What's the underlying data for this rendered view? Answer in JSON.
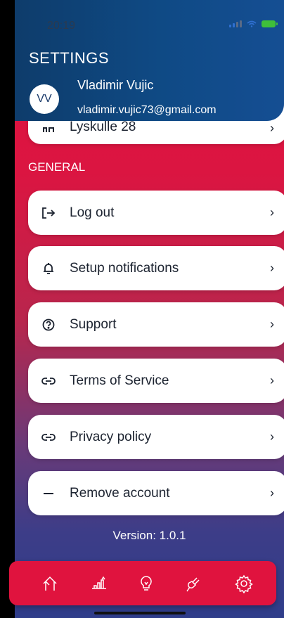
{
  "status": {
    "time": "20:19"
  },
  "header": {
    "title": "SETTINGS",
    "avatar_initials": "VV",
    "user_name": "Vladimir  Vujic",
    "user_email": "vladimir.vujic73@gmail.com"
  },
  "top_card": {
    "label": "Lyskulle 28",
    "icon": "house-icon"
  },
  "general": {
    "section_label": "GENERAL",
    "items": [
      {
        "label": "Log out",
        "icon": "log-out-icon"
      },
      {
        "label": "Setup notifications",
        "icon": "bell-icon"
      },
      {
        "label": "Support",
        "icon": "question-icon"
      },
      {
        "label": "Terms of Service",
        "icon": "link-icon"
      },
      {
        "label": "Privacy policy",
        "icon": "link-icon"
      },
      {
        "label": "Remove account",
        "icon": "minus-icon"
      }
    ],
    "chevron": "›"
  },
  "footer": {
    "version": "Version: 1.0.1"
  },
  "tabbar": {
    "items": [
      "home-icon",
      "chart-icon",
      "bulb-icon",
      "plug-icon",
      "gear-icon"
    ],
    "colors": {
      "bar": "#e0133e",
      "icon": "#ffffff"
    }
  }
}
